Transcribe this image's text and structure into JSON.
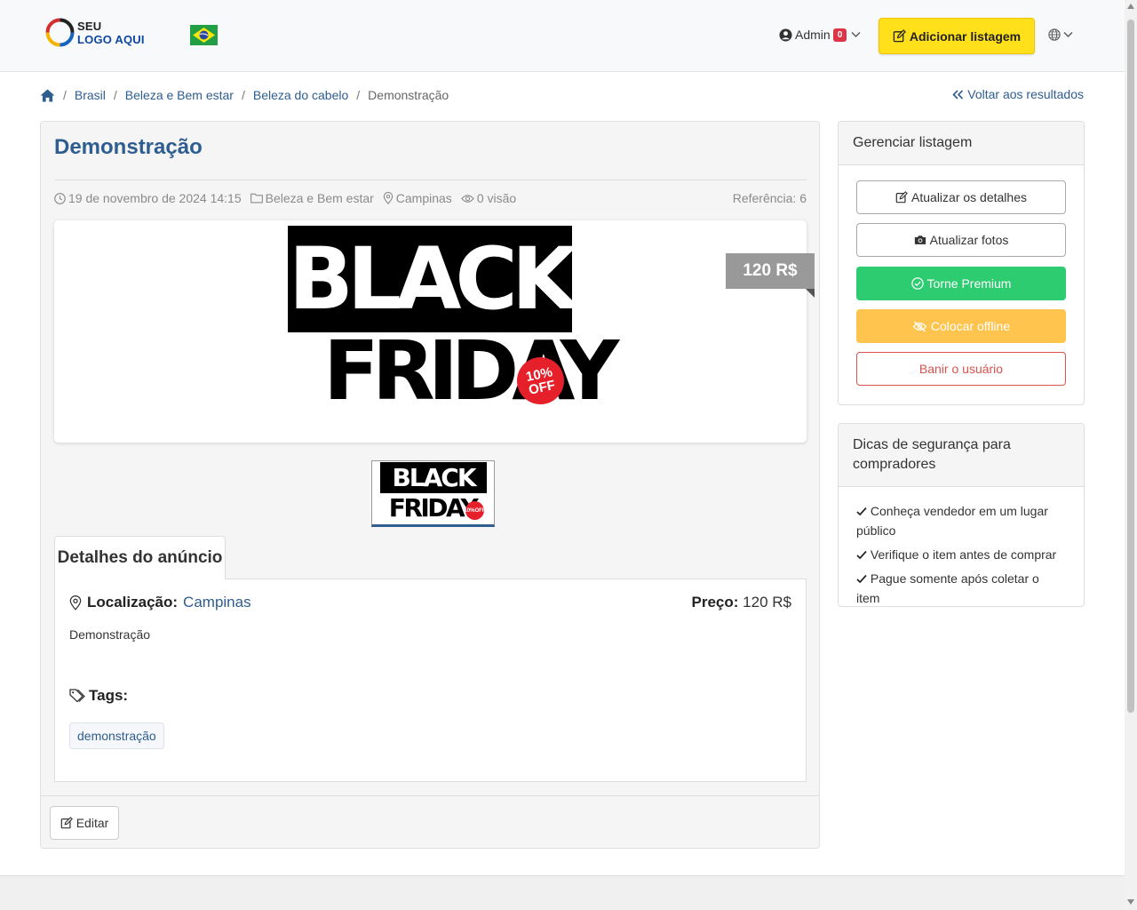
{
  "header": {
    "logo_seu": "SEU",
    "logo_text": "LOGO AQUI",
    "flag_icon": "brazil-flag-icon",
    "admin_label": "Admin",
    "admin_badge": "0",
    "add_listing_label": "Adicionar listagem",
    "language_icon": "globe-icon"
  },
  "breadcrumb": {
    "items": [
      "Brasil",
      "Beleza e Bem estar",
      "Beleza do cabelo"
    ],
    "current": "Demonstração",
    "back_label": "Voltar aos resultados"
  },
  "listing": {
    "title": "Demonstração",
    "date": "19 de novembro de 2024 14:15",
    "category": "Beleza e Bem estar",
    "city": "Campinas",
    "views": "0 visão",
    "reference": "Referência: 6",
    "price_ribbon": "120 R$",
    "image_top_text": "BLACK",
    "image_bottom_text": "FRIDAY",
    "image_off_percent": "10%",
    "image_off_text": "OFF",
    "tab_label": "Detalhes do anúncio",
    "location_label": "Localização:",
    "location_value": "Campinas",
    "price_label": "Preço:",
    "price_value": "120 R$",
    "description": "Demonstração",
    "tags_label": "Tags:",
    "tags": [
      "demonstração"
    ],
    "edit_label": "Editar"
  },
  "manage": {
    "title": "Gerenciar listagem",
    "update_details": "Atualizar os detalhes",
    "update_photos": "Atualizar fotos",
    "premium": "Torne Premium",
    "offline": "Colocar offline",
    "ban": "Banir o usuário"
  },
  "safety": {
    "title": "Dicas de segurança para compradores",
    "tips": [
      "Conheça vendedor em um lugar público",
      "Verifique o item antes de comprar",
      "Pague somente após coletar o item"
    ]
  },
  "colors": {
    "primary": "#2e5d8f",
    "accent_yellow": "#ffe01b",
    "success": "#2ecc71",
    "warning": "#ffc44d",
    "danger": "#d9534f"
  }
}
